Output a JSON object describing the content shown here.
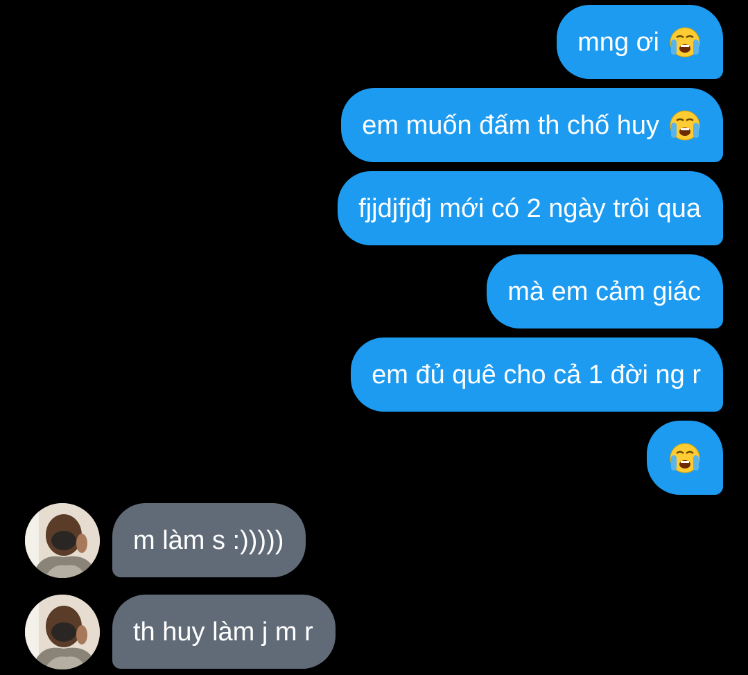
{
  "conversation": {
    "sent": [
      {
        "text": "mng ơi",
        "emoji": "loudly-crying-face-icon"
      },
      {
        "text": "em muốn đấm th chố huy",
        "emoji": "loudly-crying-face-icon"
      },
      {
        "text": "fjjdjfjđj mới có 2 ngày trôi qua",
        "emoji": ""
      },
      {
        "text": "mà em cảm giác",
        "emoji": ""
      },
      {
        "text": "em đủ quê cho cả 1 đời ng r",
        "emoji": ""
      },
      {
        "text": "",
        "emoji": "loudly-crying-face-icon"
      }
    ],
    "received": [
      {
        "text": "m làm s :)))))"
      },
      {
        "text": "th huy làm j m r"
      }
    ]
  },
  "colors": {
    "background": "#000000",
    "sent_bubble": "#1d9bf0",
    "received_bubble": "#616b78",
    "text": "#ffffff"
  }
}
